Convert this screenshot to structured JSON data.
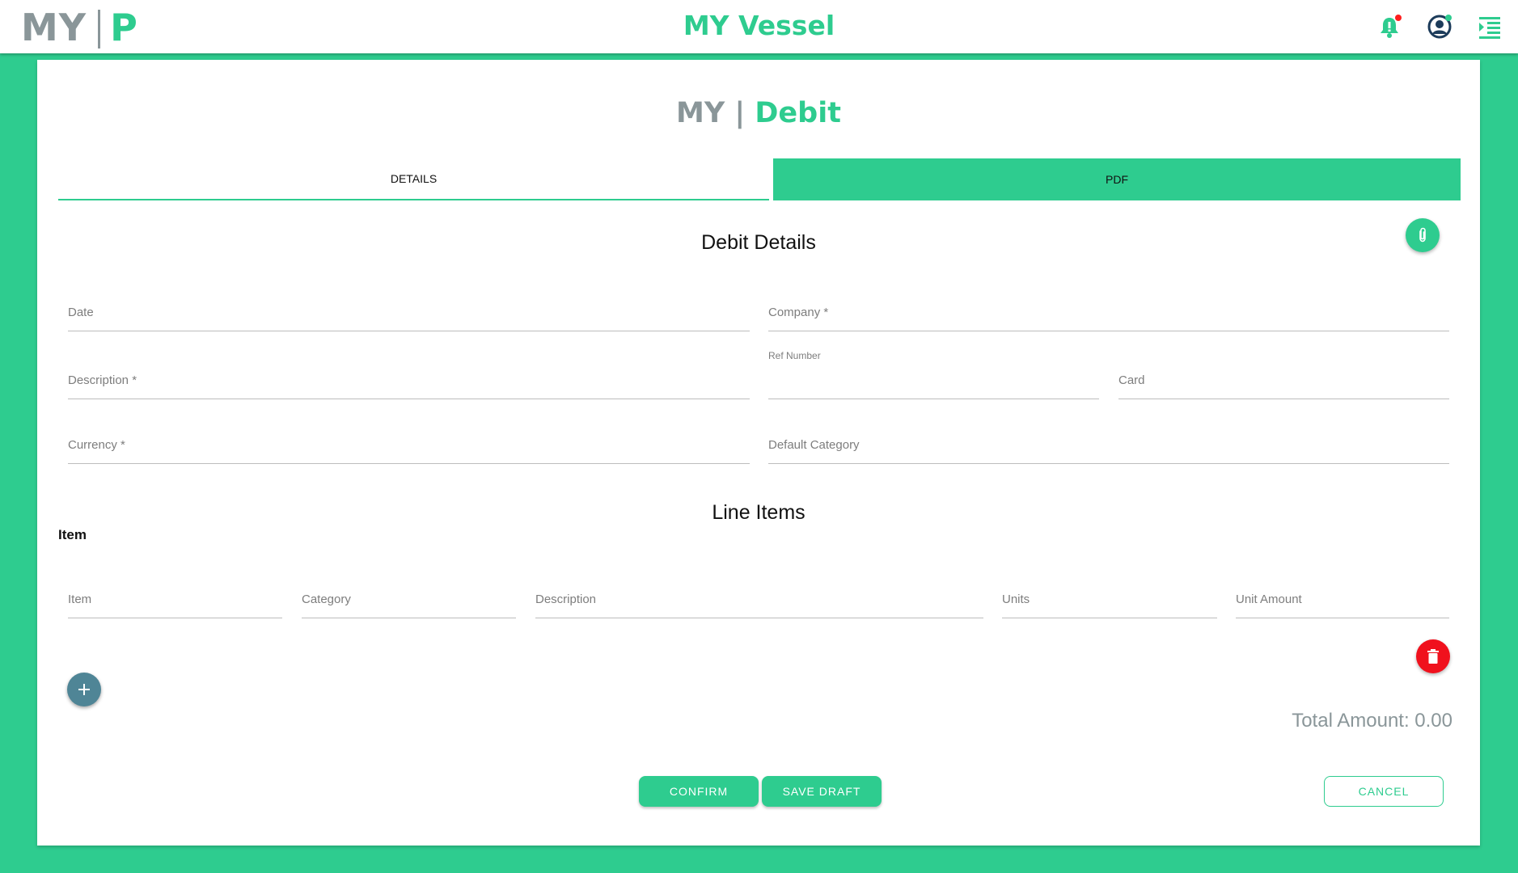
{
  "header": {
    "logo_left": "MY",
    "logo_right": "P",
    "app_title": "MY Vessel",
    "icons": [
      "bell-icon",
      "user-icon",
      "menu-indent-icon"
    ]
  },
  "page": {
    "title_prefix": "MY |",
    "title_main": "Debit"
  },
  "tabs": [
    {
      "label": "DETAILS",
      "active": true
    },
    {
      "label": "PDF",
      "active": false
    }
  ],
  "debit_details": {
    "title": "Debit Details",
    "fields": {
      "date": {
        "label": "Date",
        "value": ""
      },
      "company": {
        "label": "Company *",
        "value": ""
      },
      "description": {
        "label": "Description *",
        "value": ""
      },
      "ref_number": {
        "label": "Ref Number",
        "value": ""
      },
      "card": {
        "label": "Card",
        "value": ""
      },
      "currency": {
        "label": "Currency *",
        "value": ""
      },
      "default_category": {
        "label": "Default Category",
        "value": ""
      }
    }
  },
  "line_items": {
    "title": "Line Items",
    "item_heading": "Item",
    "columns": {
      "item": "Item",
      "category": "Category",
      "description": "Description",
      "units": "Units",
      "unit_amount": "Unit Amount"
    },
    "total_label": "Total Amount: 0.00"
  },
  "actions": {
    "confirm": "CONFIRM",
    "save_draft": "SAVE DRAFT",
    "cancel": "CANCEL"
  },
  "colors": {
    "accent": "#2ecc8f",
    "grey": "#8a9699",
    "danger": "#f0111d",
    "add_button": "#4f8596"
  }
}
